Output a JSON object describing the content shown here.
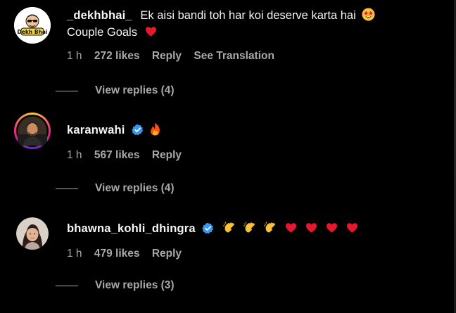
{
  "comments": [
    {
      "username": "_dekhbhai_",
      "verified": false,
      "text": "Ek aisi bandi toh har koi deserve karta hai",
      "text_emoji": "star-struck-emoji",
      "text2": "Couple Goals",
      "text2_emoji": "red-heart-emoji",
      "avatar_text": "Dekh Bhai",
      "time": "1 h",
      "likes": "272 likes",
      "reply_label": "Reply",
      "translate_label": "See Translation",
      "view_replies": "View replies (4)"
    },
    {
      "username": "karanwahi",
      "verified": true,
      "emojis": [
        "fire-emoji"
      ],
      "time": "1 h",
      "likes": "567 likes",
      "reply_label": "Reply",
      "view_replies": "View replies (4)"
    },
    {
      "username": "bhawna_kohli_dhingra",
      "verified": true,
      "emojis": [
        "clapping-hands-emoji",
        "clapping-hands-emoji",
        "clapping-hands-emoji",
        "red-heart-emoji",
        "red-heart-emoji",
        "red-heart-emoji",
        "red-heart-emoji"
      ],
      "time": "1 h",
      "likes": "479 likes",
      "reply_label": "Reply",
      "view_replies": "View replies (3)"
    }
  ],
  "colors": {
    "background": "#000000",
    "text": "#f5f5f5",
    "secondary": "#a8a8a8",
    "verified": "#3897f0",
    "heart": "#e8172b"
  }
}
